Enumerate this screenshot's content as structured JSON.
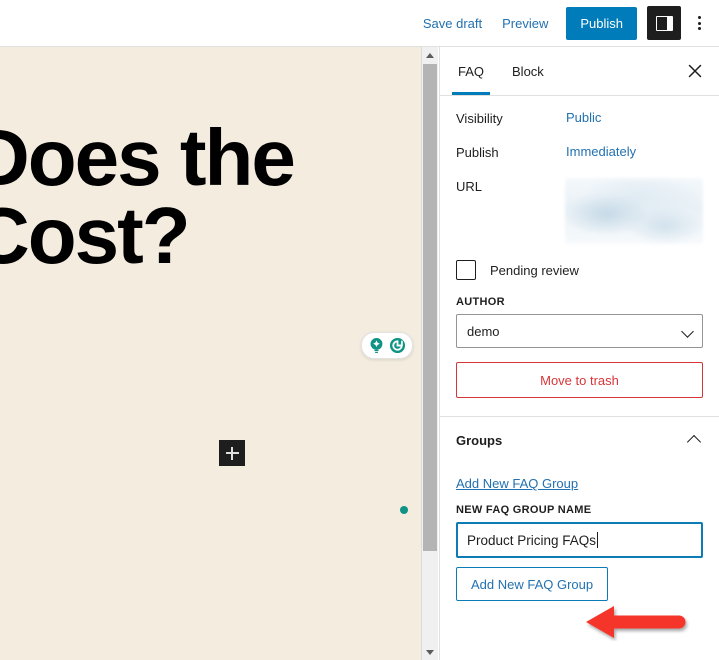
{
  "header": {
    "save_draft": "Save draft",
    "preview": "Preview",
    "publish": "Publish",
    "sidebar_toggle_icon": "sidebar-panel-icon",
    "more_menu_icon": "vertical-ellipsis-icon"
  },
  "canvas": {
    "heading": "Does the\nCost?",
    "ai_widget": {
      "lightbulb_icon": "lightbulb-icon",
      "refresh_icon": "refresh-circle-icon",
      "accent_color": "#0e9384"
    },
    "add_block_icon": "plus-icon",
    "marker_color": "#0e9384",
    "background_color": "#f4eddf"
  },
  "sidebar": {
    "tabs": [
      {
        "label": "FAQ",
        "active": true
      },
      {
        "label": "Block",
        "active": false
      }
    ],
    "close_icon": "close-icon",
    "accent_color": "#007cba",
    "status_panel": {
      "visibility_label": "Visibility",
      "visibility_value": "Public",
      "publish_label": "Publish",
      "publish_value": "Immediately",
      "url_label": "URL",
      "url_value": "",
      "pending_review_label": "Pending review",
      "pending_review_checked": false,
      "author_label": "AUTHOR",
      "author_value": "demo",
      "trash_label": "Move to trash",
      "trash_color": "#d63638"
    },
    "groups_panel": {
      "title": "Groups",
      "expanded": true,
      "collapse_icon": "chevron-up-icon",
      "add_link": "Add New FAQ Group",
      "new_group_name_label": "NEW FAQ GROUP NAME",
      "new_group_name_value": "Product Pricing FAQs",
      "new_group_name_placeholder": "",
      "add_button": "Add New FAQ Group"
    }
  },
  "annotation": {
    "arrow_color": "#f5352c",
    "arrow_direction": "left",
    "points_at": "Add New FAQ Group"
  },
  "scrollbar": {
    "up_arrow_icon": "triangle-up-icon",
    "down_arrow_icon": "triangle-down-icon"
  }
}
